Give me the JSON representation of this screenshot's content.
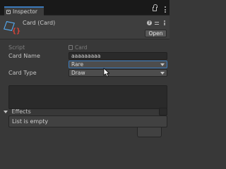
{
  "window": {
    "tab_label": "Inspector"
  },
  "header": {
    "title": "Card (Card)",
    "open_label": "Open",
    "icons": [
      "script-asset-icon",
      "help-icon",
      "preset-icon",
      "more-icon"
    ]
  },
  "fields": {
    "script": {
      "label": "Script",
      "value": "Card"
    },
    "card_name": {
      "label": "Card Name",
      "value": "aaaaaaaaa"
    },
    "rarity": {
      "value": "Rare"
    },
    "card_type": {
      "label": "Card Type",
      "value": "Draw"
    }
  },
  "effects": {
    "label": "Effects",
    "empty_text": "List is empty"
  },
  "colors": {
    "background": "#383838",
    "accent": "#3a79bb",
    "icon_blue": "#58b3ff",
    "icon_red": "#e0443a"
  }
}
